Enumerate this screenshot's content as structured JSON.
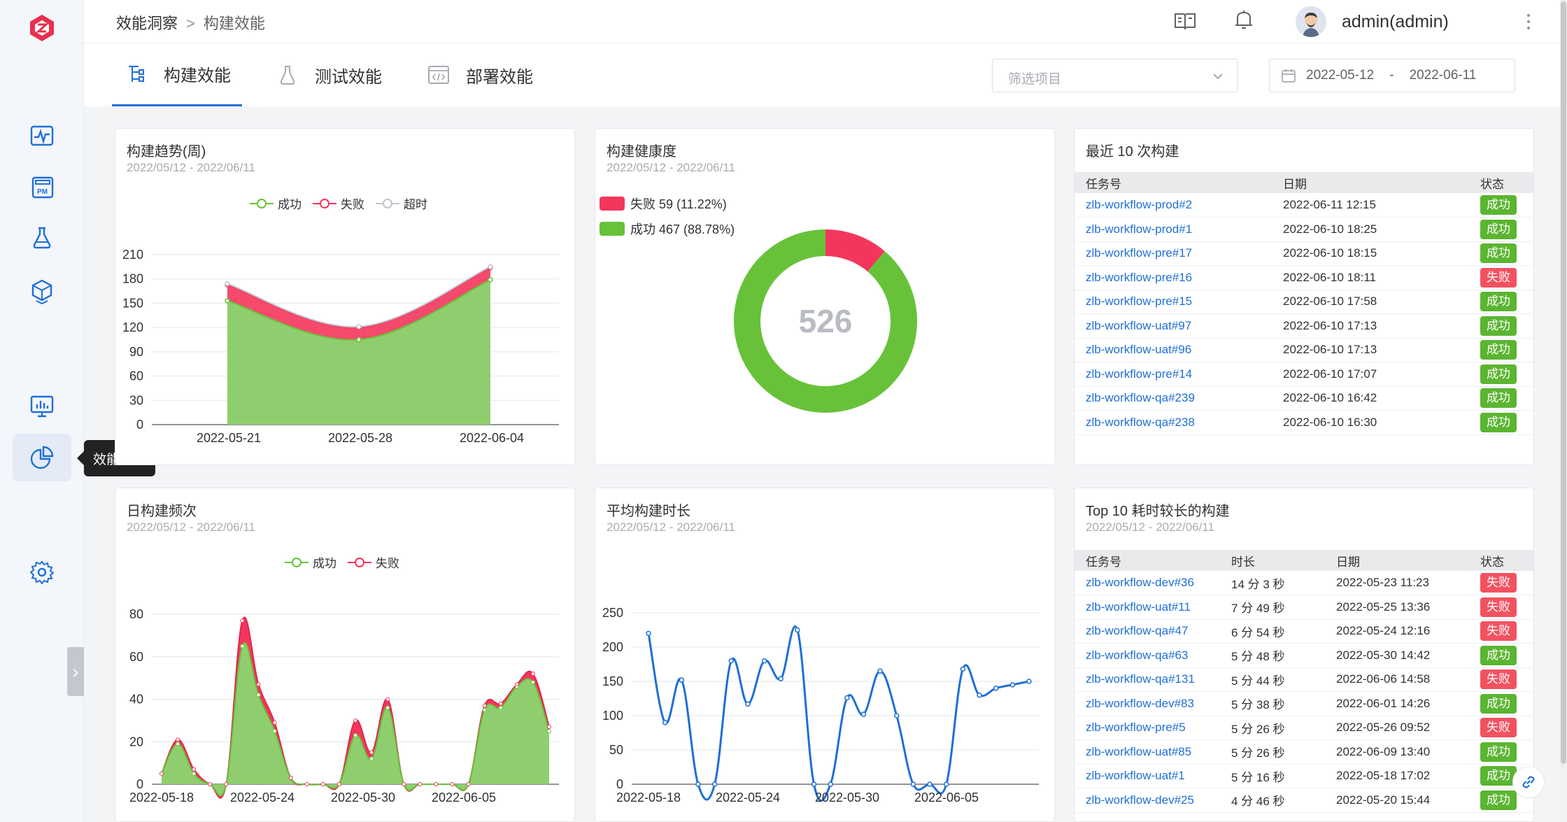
{
  "breadcrumb": {
    "parent": "效能洞察",
    "separator": ">",
    "current": "构建效能"
  },
  "user": {
    "name": "admin(admin)"
  },
  "sidebar": {
    "tooltip": "效能洞察",
    "collapse_glyph": "›"
  },
  "tabs": [
    {
      "label": "构建效能",
      "active": true
    },
    {
      "label": "测试效能",
      "active": false
    },
    {
      "label": "部署效能",
      "active": false
    }
  ],
  "filter": {
    "placeholder": "筛选项目"
  },
  "daterange": {
    "start": "2022-05-12",
    "separator": "-",
    "end": "2022-06-11"
  },
  "colors": {
    "success": "#67c23a",
    "fail": "#f5365c",
    "timeout": "#c0c4cc",
    "line": "#1f6fd6",
    "badge_ok": "#5bb531",
    "badge_fail": "#f25260"
  },
  "cards": {
    "trend": {
      "title": "构建趋势(周)",
      "subtitle": "2022/05/12 - 2022/06/11"
    },
    "health": {
      "title": "构建健康度",
      "subtitle": "2022/05/12 - 2022/06/11",
      "fail_label": "失败 59 (11.22%)",
      "ok_label": "成功 467 (88.78%)",
      "total": "526"
    },
    "recent": {
      "title": "最近 10 次构建",
      "headers": [
        "任务号",
        "日期",
        "状态"
      ],
      "rows": [
        {
          "task": "zlb-workflow-prod#2",
          "date": "2022-06-11 12:15",
          "status": "成功",
          "ok": true
        },
        {
          "task": "zlb-workflow-prod#1",
          "date": "2022-06-10 18:25",
          "status": "成功",
          "ok": true
        },
        {
          "task": "zlb-workflow-pre#17",
          "date": "2022-06-10 18:15",
          "status": "成功",
          "ok": true
        },
        {
          "task": "zlb-workflow-pre#16",
          "date": "2022-06-10 18:11",
          "status": "失败",
          "ok": false
        },
        {
          "task": "zlb-workflow-pre#15",
          "date": "2022-06-10 17:58",
          "status": "成功",
          "ok": true
        },
        {
          "task": "zlb-workflow-uat#97",
          "date": "2022-06-10 17:13",
          "status": "成功",
          "ok": true
        },
        {
          "task": "zlb-workflow-uat#96",
          "date": "2022-06-10 17:13",
          "status": "成功",
          "ok": true
        },
        {
          "task": "zlb-workflow-pre#14",
          "date": "2022-06-10 17:07",
          "status": "成功",
          "ok": true
        },
        {
          "task": "zlb-workflow-qa#239",
          "date": "2022-06-10 16:42",
          "status": "成功",
          "ok": true
        },
        {
          "task": "zlb-workflow-qa#238",
          "date": "2022-06-10 16:30",
          "status": "成功",
          "ok": true
        }
      ]
    },
    "daily": {
      "title": "日构建频次",
      "subtitle": "2022/05/12 - 2022/06/11"
    },
    "avg": {
      "title": "平均构建时长",
      "subtitle": "2022/05/12 - 2022/06/11"
    },
    "top": {
      "title": "Top 10 耗时较长的构建",
      "subtitle": "2022/05/12 - 2022/06/11",
      "headers": [
        "任务号",
        "时长",
        "日期",
        "状态"
      ],
      "rows": [
        {
          "task": "zlb-workflow-dev#36",
          "duration": "14 分 3 秒",
          "date": "2022-05-23 11:23",
          "status": "失败",
          "ok": false
        },
        {
          "task": "zlb-workflow-uat#11",
          "duration": "7 分 49 秒",
          "date": "2022-05-25 13:36",
          "status": "失败",
          "ok": false
        },
        {
          "task": "zlb-workflow-qa#47",
          "duration": "6 分 54 秒",
          "date": "2022-05-24 12:16",
          "status": "失败",
          "ok": false
        },
        {
          "task": "zlb-workflow-qa#63",
          "duration": "5 分 48 秒",
          "date": "2022-05-30 14:42",
          "status": "成功",
          "ok": true
        },
        {
          "task": "zlb-workflow-qa#131",
          "duration": "5 分 44 秒",
          "date": "2022-06-06 14:58",
          "status": "失败",
          "ok": false
        },
        {
          "task": "zlb-workflow-dev#83",
          "duration": "5 分 38 秒",
          "date": "2022-06-01 14:26",
          "status": "成功",
          "ok": true
        },
        {
          "task": "zlb-workflow-pre#5",
          "duration": "5 分 26 秒",
          "date": "2022-05-26 09:52",
          "status": "失败",
          "ok": false
        },
        {
          "task": "zlb-workflow-uat#85",
          "duration": "5 分 26 秒",
          "date": "2022-06-09 13:40",
          "status": "成功",
          "ok": true
        },
        {
          "task": "zlb-workflow-uat#1",
          "duration": "5 分 16 秒",
          "date": "2022-05-18 17:02",
          "status": "成功",
          "ok": true
        },
        {
          "task": "zlb-workflow-dev#25",
          "duration": "4 分 46 秒",
          "date": "2022-05-20 15:44",
          "status": "成功",
          "ok": true
        }
      ]
    }
  },
  "chart_data": [
    {
      "id": "trend",
      "type": "area",
      "title": "构建趋势(周)",
      "categories": [
        "2022-05-21",
        "2022-05-28",
        "2022-06-04"
      ],
      "yticks": [
        0,
        30,
        60,
        90,
        120,
        150,
        180,
        210
      ],
      "ylim": [
        0,
        210
      ],
      "series": [
        {
          "name": "成功",
          "values": [
            153,
            105,
            179
          ]
        },
        {
          "name": "失败",
          "values": [
            20,
            15,
            15
          ]
        },
        {
          "name": "超时",
          "values": [
            1,
            1,
            1
          ]
        }
      ]
    },
    {
      "id": "health",
      "type": "pie",
      "slices": [
        {
          "label": "失败",
          "value": 59,
          "pct": "11.22%"
        },
        {
          "label": "成功",
          "value": 467,
          "pct": "88.78%"
        }
      ],
      "total": 526
    },
    {
      "id": "daily",
      "type": "area",
      "title": "日构建频次",
      "x": [
        "2022-05-12",
        "2022-05-13",
        "2022-05-14",
        "2022-05-15",
        "2022-05-16",
        "2022-05-17",
        "2022-05-18",
        "2022-05-19",
        "2022-05-20",
        "2022-05-21",
        "2022-05-22",
        "2022-05-23",
        "2022-05-24",
        "2022-05-25",
        "2022-05-26",
        "2022-05-27",
        "2022-05-28",
        "2022-05-29",
        "2022-05-30",
        "2022-05-31",
        "2022-06-01",
        "2022-06-02",
        "2022-06-03",
        "2022-06-04",
        "2022-06-05",
        "2022-06-06",
        "2022-06-07",
        "2022-06-08",
        "2022-06-09",
        "2022-06-10",
        "2022-06-11"
      ],
      "xticks": [
        "2022-05-18",
        "2022-05-24",
        "2022-05-30",
        "2022-06-05"
      ],
      "yticks": [
        0,
        20,
        40,
        60,
        80
      ],
      "ylim": [
        0,
        80
      ],
      "series": [
        {
          "name": "成功",
          "values": [
            5,
            19,
            5,
            0,
            0,
            65,
            42,
            25,
            3,
            0,
            0,
            0,
            23,
            12,
            36,
            0,
            0,
            0,
            0,
            0,
            35,
            36,
            46,
            48,
            25
          ]
        },
        {
          "name": "失败",
          "values": [
            0,
            2,
            2,
            0,
            0,
            12,
            5,
            4,
            0,
            0,
            0,
            0,
            7,
            3,
            4,
            0,
            0,
            0,
            0,
            0,
            2,
            2,
            1,
            4,
            2
          ]
        }
      ]
    },
    {
      "id": "avg",
      "type": "line",
      "title": "平均构建时长",
      "x": [
        "2022-05-12",
        "2022-05-13",
        "2022-05-14",
        "2022-05-15",
        "2022-05-16",
        "2022-05-17",
        "2022-05-18",
        "2022-05-19",
        "2022-05-20",
        "2022-05-21",
        "2022-05-22",
        "2022-05-23",
        "2022-05-24",
        "2022-05-25",
        "2022-05-26",
        "2022-05-27",
        "2022-05-28",
        "2022-05-29",
        "2022-05-30",
        "2022-05-31",
        "2022-06-01",
        "2022-06-02",
        "2022-06-03",
        "2022-06-04",
        "2022-06-05",
        "2022-06-06",
        "2022-06-07",
        "2022-06-08",
        "2022-06-09",
        "2022-06-10",
        "2022-06-11"
      ],
      "xticks": [
        "2022-05-18",
        "2022-05-24",
        "2022-05-30",
        "2022-06-05"
      ],
      "yticks": [
        0,
        50,
        100,
        150,
        200,
        250
      ],
      "ylim": [
        0,
        250
      ],
      "series": [
        {
          "name": "",
          "values": [
            220,
            90,
            152,
            0,
            0,
            180,
            117,
            180,
            154,
            225,
            0,
            0,
            126,
            102,
            165,
            100,
            0,
            0,
            0,
            168,
            130,
            140,
            145,
            150
          ]
        }
      ]
    }
  ]
}
